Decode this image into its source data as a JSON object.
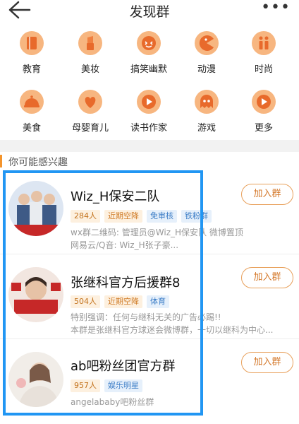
{
  "header": {
    "title": "发现群",
    "more_label": "•••"
  },
  "categories": [
    {
      "label": "教育",
      "icon": "book-icon",
      "color": "#f2a154"
    },
    {
      "label": "美妆",
      "icon": "lipstick-icon",
      "color": "#f2a154"
    },
    {
      "label": "搞笑幽默",
      "icon": "smile-icon",
      "color": "#f2a154"
    },
    {
      "label": "动漫",
      "icon": "pacman-icon",
      "color": "#f2a154"
    },
    {
      "label": "时尚",
      "icon": "fashion-icon",
      "color": "#f2a154"
    },
    {
      "label": "美食",
      "icon": "food-icon",
      "color": "#f2a154"
    },
    {
      "label": "母婴育儿",
      "icon": "heart-icon",
      "color": "#f2a154"
    },
    {
      "label": "读书作家",
      "icon": "play-icon",
      "color": "#f2a154"
    },
    {
      "label": "游戏",
      "icon": "ghost-icon",
      "color": "#f2a154"
    },
    {
      "label": "更多",
      "icon": "more-play-icon",
      "color": "#f2a154"
    }
  ],
  "section": {
    "title": "你可能感兴趣"
  },
  "groups": [
    {
      "name": "Wiz_H保安二队",
      "tags": [
        {
          "text": "284人",
          "kind": "count"
        },
        {
          "text": "近期空降",
          "kind": "orange"
        },
        {
          "text": "免审核",
          "kind": "blue"
        },
        {
          "text": "铁粉群",
          "kind": "blue"
        }
      ],
      "desc": [
        "wx群二维码: 管理员@Wiz_H保安队 微博置顶",
        "网易云/Q音: Wiz_H张子豪..."
      ],
      "join_label": "加入群"
    },
    {
      "name": "张继科官方后援群8",
      "tags": [
        {
          "text": "504人",
          "kind": "count"
        },
        {
          "text": "近期空降",
          "kind": "orange"
        },
        {
          "text": "体育",
          "kind": "blue"
        }
      ],
      "desc": [
        "特别强调：任何与继科无关的广告必踢!!",
        "本群是张继科官方球迷会微博群，一切以继科为中心..."
      ],
      "join_label": "加入群"
    },
    {
      "name": "ab吧粉丝团官方群",
      "tags": [
        {
          "text": "957人",
          "kind": "count"
        },
        {
          "text": "娱乐明星",
          "kind": "blue"
        }
      ],
      "desc": [
        "angelababy吧粉丝群"
      ],
      "join_label": "加入群"
    }
  ],
  "colors": {
    "accent": "#f4942c",
    "highlight": "#2196f3"
  }
}
